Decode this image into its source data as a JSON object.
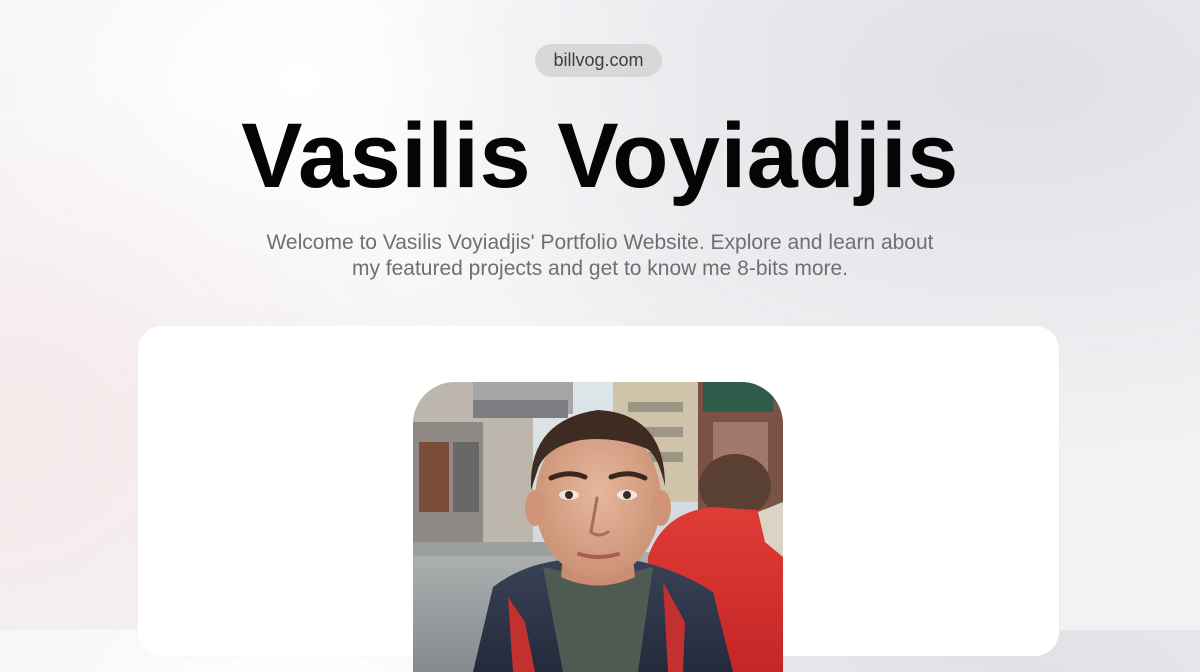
{
  "site": {
    "domain": "billvog.com"
  },
  "hero": {
    "title": "Vasilis Voyiadjis",
    "subtitle": "Welcome to Vasilis Voyiadjis' Portfolio Website. Explore and learn about my featured projects and get to know me 8-bits more."
  },
  "colors": {
    "title": "#050505",
    "subtitle": "#6f6f73",
    "pill_bg": "#d8d8db",
    "card_bg": "#ffffff"
  }
}
